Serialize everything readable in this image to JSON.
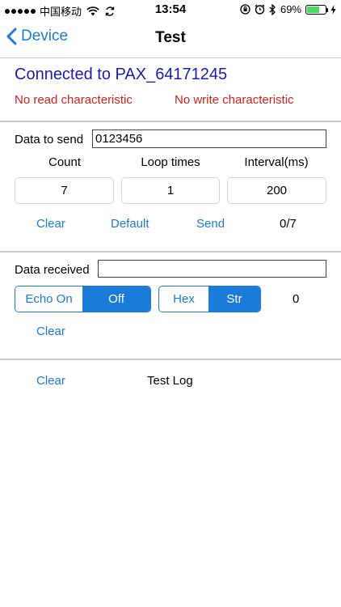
{
  "status_bar": {
    "carrier": "中国移动",
    "time": "13:54",
    "battery": "69%",
    "battery_level": 0.69
  },
  "nav": {
    "back_label": "Device",
    "title": "Test"
  },
  "connection": {
    "connected_text": "Connected to PAX_64171245",
    "read_status": "No read characteristic",
    "write_status": "No write characteristic"
  },
  "send": {
    "label": "Data to send",
    "value": "0123456",
    "columns": [
      "Count",
      "Loop times",
      "Interval(ms)"
    ],
    "count": "7",
    "loop_times": "1",
    "interval": "200",
    "clear_label": "Clear",
    "default_label": "Default",
    "send_label": "Send",
    "progress": "0/7"
  },
  "receive": {
    "label": "Data received",
    "value": "",
    "echo_on_label": "Echo On",
    "echo_off_label": "Off",
    "hex_label": "Hex",
    "str_label": "Str",
    "count": "0",
    "clear_label": "Clear"
  },
  "log": {
    "clear_label": "Clear",
    "title": "Test Log"
  }
}
